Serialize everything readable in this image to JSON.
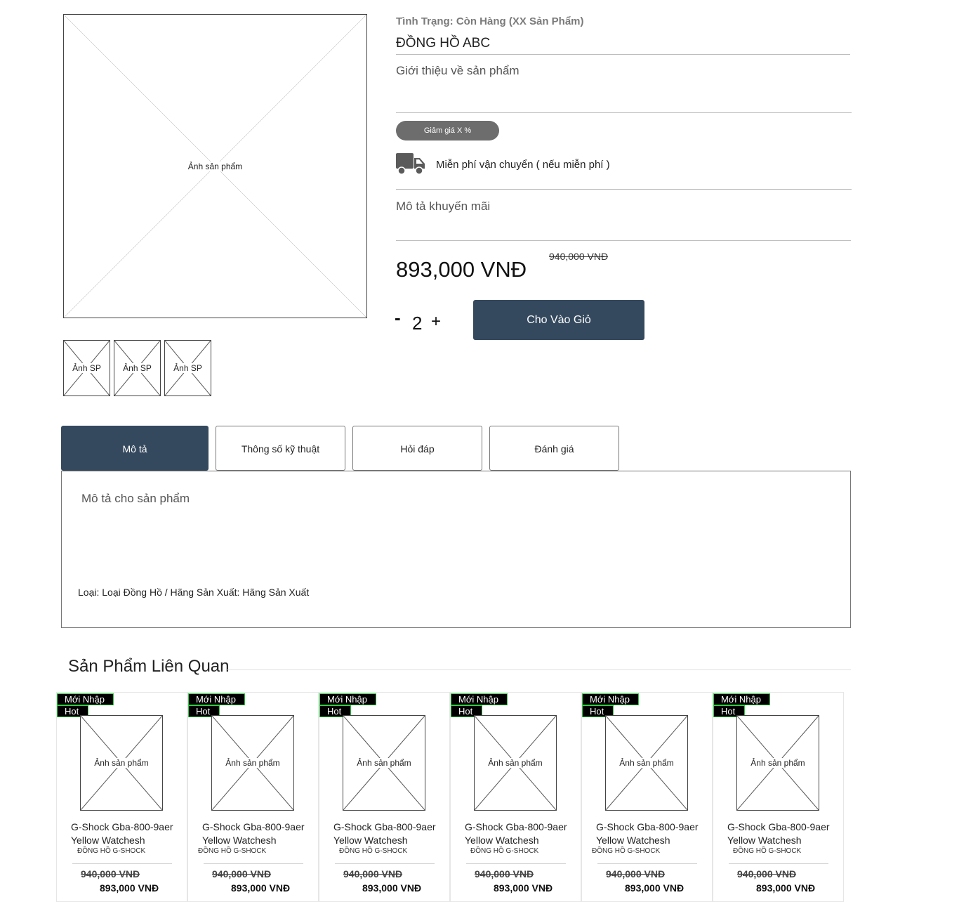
{
  "product": {
    "status": "Tình Trạng: Còn Hàng (XX Sản Phẩm)",
    "title": "ĐỒNG HỒ ABC",
    "intro": "Giới thiệu về sản phẩm",
    "discount": "Giảm giá X %",
    "truck_icon": "truck-icon",
    "shipping": "Miễn phí vận chuyển ( nếu miễn phí )",
    "promo": "Mô tả khuyến mãi",
    "price": "893,000 VNĐ",
    "old_price": "940,000 VNĐ",
    "main_image_label": "Ảnh sản phẩm",
    "thumbnails": [
      "Ảnh SP",
      "Ảnh SP",
      "Ảnh SP"
    ]
  },
  "quantity": {
    "minus": "-",
    "value": "2",
    "plus": "+"
  },
  "cart_button": "Cho Vào Giỏ",
  "tabs": [
    {
      "label": "Mô tả",
      "active": true
    },
    {
      "label": "Thông số kỹ thuật",
      "active": false
    },
    {
      "label": "Hỏi đáp",
      "active": false
    },
    {
      "label": "Đánh giá",
      "active": false
    }
  ],
  "tab_content": {
    "description": "Mô tả cho sản phẩm",
    "meta": "Loại: Loại Đồng Hồ  / Hãng Sản Xuất: Hãng Sản Xuất"
  },
  "related": {
    "title": "Sản Phẩm Liên Quan",
    "items": [
      {
        "badge_new": "Mới Nhập",
        "badge_hot": "Hot",
        "image_label": "Ảnh sản phẩm",
        "name": "G-Shock Gba-800-9aer Yellow Watchesh",
        "brand": "ĐỒNG HỒ G-SHOCK",
        "old_price": "940,000 VNĐ",
        "price": "893,000 VNĐ"
      },
      {
        "badge_new": "Mới Nhập",
        "badge_hot": "Hot",
        "image_label": "Ảnh sản phẩm",
        "name": "G-Shock Gba-800-9aer Yellow Watchesh",
        "brand": "ĐỒNG HỒ G-SHOCK",
        "old_price": "940,000 VNĐ",
        "price": "893,000 VNĐ"
      },
      {
        "badge_new": "Mới Nhập",
        "badge_hot": "Hot",
        "image_label": "Ảnh sản phẩm",
        "name": "G-Shock Gba-800-9aer Yellow Watchesh",
        "brand": "ĐỒNG HỒ G-SHOCK",
        "old_price": "940,000 VNĐ",
        "price": "893,000 VNĐ"
      },
      {
        "badge_new": "Mới Nhập",
        "badge_hot": "Hot",
        "image_label": "Ảnh sản phẩm",
        "name": "G-Shock Gba-800-9aer Yellow Watchesh",
        "brand": "ĐỒNG HỒ G-SHOCK",
        "old_price": "940,000 VNĐ",
        "price": "893,000 VNĐ"
      },
      {
        "badge_new": "Mới Nhập",
        "badge_hot": "Hot",
        "image_label": "Ảnh sản phẩm",
        "name": "G-Shock Gba-800-9aer Yellow Watchesh",
        "brand": "ĐỒNG HỒ G-SHOCK",
        "old_price": "940,000 VNĐ",
        "price": "893,000 VNĐ"
      },
      {
        "badge_new": "Mới Nhập",
        "badge_hot": "Hot",
        "image_label": "Ảnh sản phẩm",
        "name": "G-Shock Gba-800-9aer Yellow Watchesh",
        "brand": "ĐỒNG HỒ G-SHOCK",
        "old_price": "940,000 VNĐ",
        "price": "893,000 VNĐ"
      }
    ]
  },
  "colors": {
    "accent": "#35495e",
    "badge_bg": "#000000",
    "badge_border": "#2ecc40",
    "discount_bg": "#6d6d6d"
  }
}
